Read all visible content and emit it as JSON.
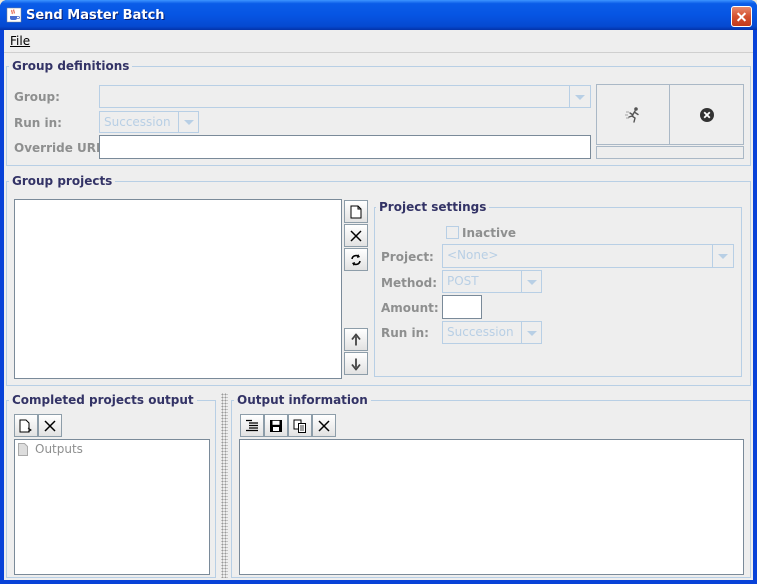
{
  "window": {
    "title": "Send Master Batch"
  },
  "menu": {
    "file": "File"
  },
  "group_definitions": {
    "title": "Group definitions",
    "group_label": "Group:",
    "group_value": "",
    "run_in_label": "Run in:",
    "run_in_value": "Succession",
    "override_url_label": "Override URL:",
    "override_url_value": ""
  },
  "group_projects": {
    "title": "Group projects"
  },
  "project_settings": {
    "title": "Project settings",
    "inactive_label": "Inactive",
    "project_label": "Project:",
    "project_value": "<None>",
    "method_label": "Method:",
    "method_value": "POST",
    "amount_label": "Amount:",
    "amount_value": "",
    "run_in_label": "Run in:",
    "run_in_value": "Succession"
  },
  "completed_output": {
    "title": "Completed projects output",
    "tree_root": "Outputs"
  },
  "output_information": {
    "title": "Output information"
  },
  "icons": {
    "app": "java-cup-icon",
    "run": "running-man-icon",
    "stop": "stop-circle-icon"
  },
  "colors": {
    "titlebar": "#0655e3",
    "group_title": "#333366",
    "disabled_text": "#b8cfe5",
    "close": "#d4512f"
  }
}
